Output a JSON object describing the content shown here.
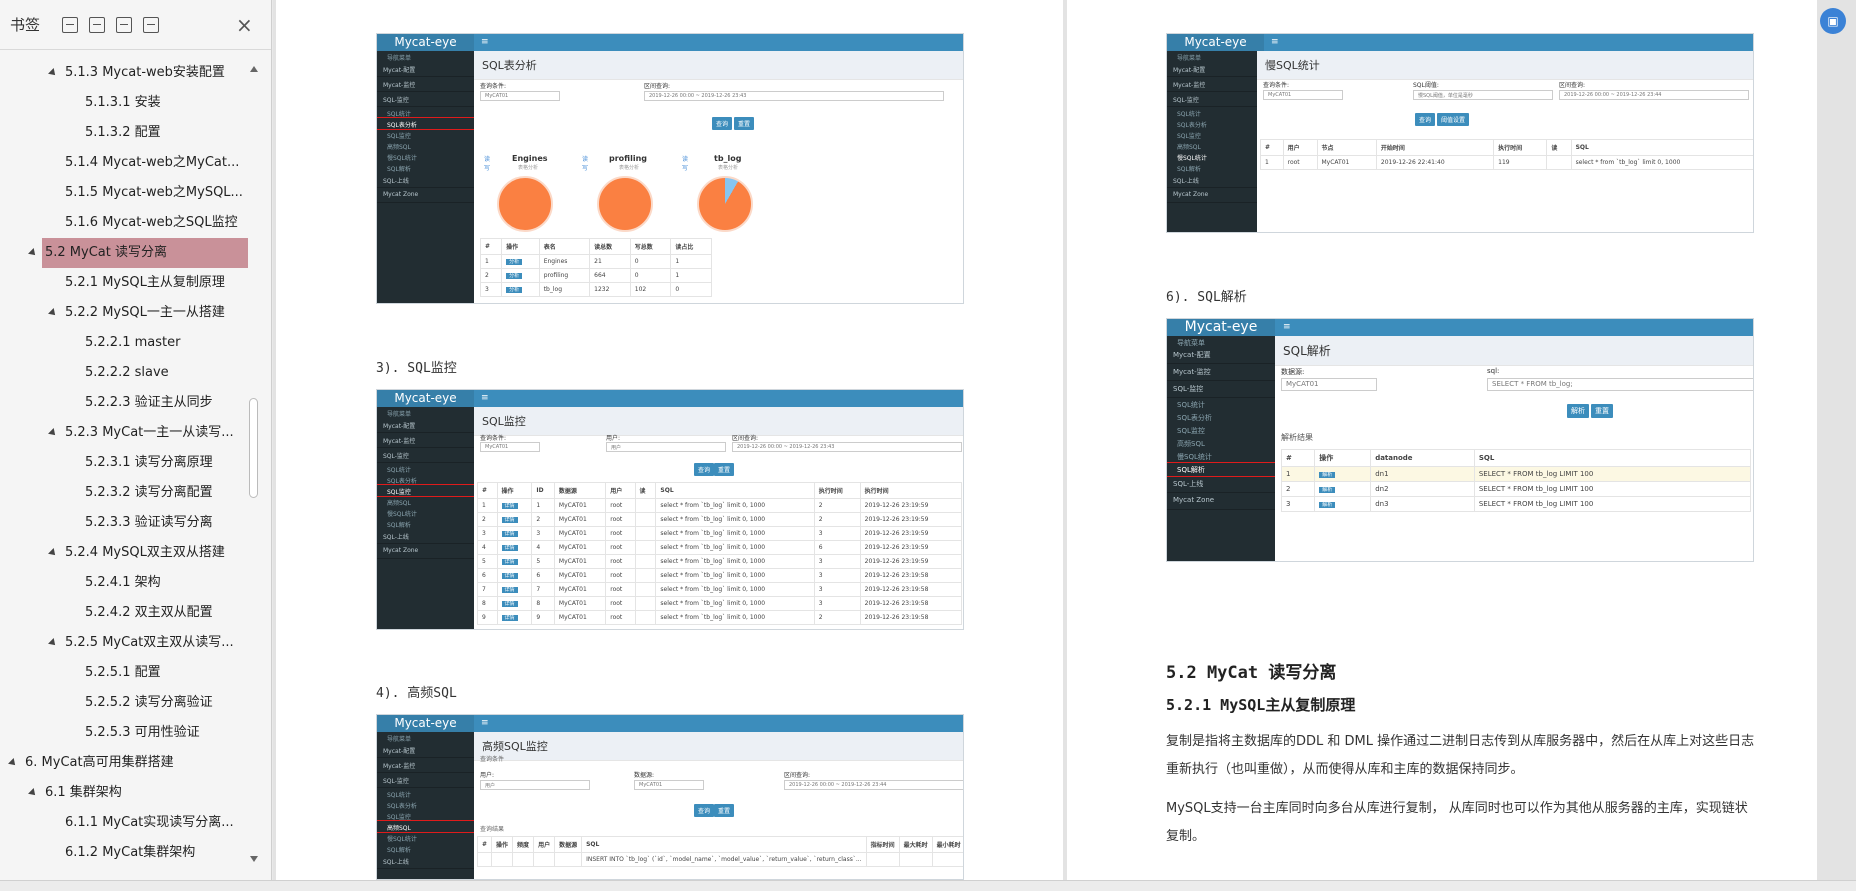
{
  "sidebar": {
    "title": "书签",
    "items": [
      {
        "label": "5.1.3 Mycat-web安装配置",
        "level": 3,
        "expanded": true
      },
      {
        "label": "5.1.3.1 安装",
        "level": 4
      },
      {
        "label": "5.1.3.2 配置",
        "level": 4
      },
      {
        "label": "5.1.4 Mycat-web之MyCat...",
        "level": 3
      },
      {
        "label": "5.1.5 Mycat-web之MySQL...",
        "level": 3
      },
      {
        "label": "5.1.6 Mycat-web之SQL监控",
        "level": 3
      },
      {
        "label": "5.2 MyCat 读写分离",
        "level": 2,
        "expanded": true,
        "selected": true
      },
      {
        "label": "5.2.1 MySQL主从复制原理",
        "level": 3
      },
      {
        "label": "5.2.2 MySQL一主一从搭建",
        "level": 3,
        "expanded": true
      },
      {
        "label": "5.2.2.1 master",
        "level": 4
      },
      {
        "label": "5.2.2.2 slave",
        "level": 4
      },
      {
        "label": "5.2.2.3 验证主从同步",
        "level": 4
      },
      {
        "label": "5.2.3 MyCat一主一从读写...",
        "level": 3,
        "expanded": true
      },
      {
        "label": "5.2.3.1 读写分离原理",
        "level": 4
      },
      {
        "label": "5.2.3.2 读写分离配置",
        "level": 4
      },
      {
        "label": "5.2.3.3 验证读写分离",
        "level": 4
      },
      {
        "label": "5.2.4 MySQL双主双从搭建",
        "level": 3,
        "expanded": true
      },
      {
        "label": "5.2.4.1 架构",
        "level": 4
      },
      {
        "label": "5.2.4.2 双主双从配置",
        "level": 4
      },
      {
        "label": "5.2.5 MyCat双主双从读写...",
        "level": 3,
        "expanded": true
      },
      {
        "label": "5.2.5.1 配置",
        "level": 4
      },
      {
        "label": "5.2.5.2 读写分离验证",
        "level": 4
      },
      {
        "label": "5.2.5.3 可用性验证",
        "level": 4
      },
      {
        "label": "6. MyCat高可用集群搭建",
        "level": 1,
        "expanded": true
      },
      {
        "label": "6.1 集群架构",
        "level": 2,
        "expanded": true
      },
      {
        "label": "6.1.1 MyCat实现读写分离...",
        "level": 3
      },
      {
        "label": "6.1.2 MyCat集群架构",
        "level": 3
      }
    ]
  },
  "shots": {
    "logo": "Mycat-eye",
    "menu_label": "导航菜单",
    "nav": [
      "Mycat-配置",
      "Mycat-监控",
      "SQL-监控",
      "SQL-上线",
      "Mycat Zone"
    ],
    "subnav": [
      "SQL统计",
      "SQL表分析",
      "SQL监控",
      "高频SQL",
      "慢SQL统计",
      "SQL解析"
    ],
    "query_btn": "查询",
    "reset_btn": "重置",
    "table_analysis": {
      "title": "SQL表分析",
      "label_cond": "查询条件:",
      "label_range": "区间查询:",
      "db": "MyCAT01",
      "range": "2019-12-26 00:00 ~ 2019-12-26 23:43",
      "pies": [
        {
          "name": "Engines",
          "sub": "表格分析"
        },
        {
          "name": "profiling",
          "sub": "表格分析"
        },
        {
          "name": "tb_log",
          "sub": "表格分析"
        }
      ],
      "legend": [
        "读",
        "写"
      ],
      "headers": [
        "#",
        "操作",
        "表名",
        "读总数",
        "写总数",
        "读占比"
      ],
      "rows": [
        [
          "1",
          "分析",
          "Engines",
          "21",
          "0",
          "1"
        ],
        [
          "2",
          "分析",
          "profiling",
          "664",
          "0",
          "1"
        ],
        [
          "3",
          "分析",
          "tb_log",
          "1232",
          "102",
          "0"
        ]
      ]
    },
    "sql_monitor": {
      "title": "SQL监控",
      "label_cond": "查询条件:",
      "label_user": "用户:",
      "label_range": "区间查询:",
      "user_ph": "用户",
      "db": "MyCAT01",
      "range": "2019-12-26 00:00 ~ 2019-12-26 23:43",
      "headers": [
        "#",
        "操作",
        "ID",
        "数据源",
        "用户",
        "读",
        "SQL",
        "执行时间",
        "执行时间"
      ],
      "rows": [
        [
          "1",
          "详情",
          "1",
          "MyCAT01",
          "root",
          "",
          "select * from `tb_log` limit 0, 1000",
          "2",
          "2019-12-26 23:19:59"
        ],
        [
          "2",
          "详情",
          "2",
          "MyCAT01",
          "root",
          "",
          "select * from `tb_log` limit 0, 1000",
          "2",
          "2019-12-26 23:19:59"
        ],
        [
          "3",
          "详情",
          "3",
          "MyCAT01",
          "root",
          "",
          "select * from `tb_log` limit 0, 1000",
          "3",
          "2019-12-26 23:19:59"
        ],
        [
          "4",
          "详情",
          "4",
          "MyCAT01",
          "root",
          "",
          "select * from `tb_log` limit 0, 1000",
          "6",
          "2019-12-26 23:19:59"
        ],
        [
          "5",
          "详情",
          "5",
          "MyCAT01",
          "root",
          "",
          "select * from `tb_log` limit 0, 1000",
          "3",
          "2019-12-26 23:19:59"
        ],
        [
          "6",
          "详情",
          "6",
          "MyCAT01",
          "root",
          "",
          "select * from `tb_log` limit 0, 1000",
          "3",
          "2019-12-26 23:19:58"
        ],
        [
          "7",
          "详情",
          "7",
          "MyCAT01",
          "root",
          "",
          "select * from `tb_log` limit 0, 1000",
          "3",
          "2019-12-26 23:19:58"
        ],
        [
          "8",
          "详情",
          "8",
          "MyCAT01",
          "root",
          "",
          "select * from `tb_log` limit 0, 1000",
          "3",
          "2019-12-26 23:19:58"
        ],
        [
          "9",
          "详情",
          "9",
          "MyCAT01",
          "root",
          "",
          "select * from `tb_log` limit 0, 1000",
          "2",
          "2019-12-26 23:19:58"
        ]
      ]
    },
    "freq_sql": {
      "title": "高频SQL监控",
      "cond_section": "查询条件",
      "label_user": "用户:",
      "label_db": "数据源:",
      "label_range": "区间查询:",
      "user_ph": "用户",
      "db": "MyCAT01",
      "range": "2019-12-26 00:00 ~ 2019-12-26 23:44",
      "result_section": "查询结果",
      "headers": [
        "#",
        "操作",
        "频度",
        "用户",
        "数据源",
        "SQL",
        "指标时间",
        "最大耗时",
        "最小耗时"
      ],
      "rows": [
        [
          "",
          "",
          "",
          "",
          "",
          "INSERT INTO `tb_log` (`id`, `model_name`, `model_value`, `return_value`, `return_class`...",
          "",
          "",
          ""
        ]
      ]
    },
    "slow_sql": {
      "title": "慢SQL统计",
      "label_cond": "查询条件:",
      "label_sql": "SQL阈值:",
      "label_range": "区间查询:",
      "db": "MyCAT01",
      "sql_ph": "慢SQL阈值，单位是毫秒",
      "range": "2019-12-26 00:00 ~ 2019-12-26 23:44",
      "btn_threshold": "阈值设置",
      "headers": [
        "#",
        "用户",
        "节点",
        "开始时间",
        "执行时间",
        "读",
        "SQL"
      ],
      "rows": [
        [
          "1",
          "root",
          "MyCAT01",
          "2019-12-26 22:41:40",
          "119",
          "",
          "select * from `tb_log` limit 0, 1000"
        ]
      ]
    },
    "sql_parse": {
      "title": "SQL解析",
      "label_db": "数据源:",
      "label_sql": "sql:",
      "db": "MyCAT01",
      "sql_value": "SELECT * FROM tb_log;",
      "btn_parse": "解析",
      "result_section": "解析结果",
      "headers": [
        "#",
        "操作",
        "datanode",
        "SQL"
      ],
      "rows": [
        [
          "1",
          "解析",
          "dn1",
          "SELECT * FROM tb_log LIMIT 100"
        ],
        [
          "2",
          "解析",
          "dn2",
          "SELECT * FROM tb_log LIMIT 100"
        ],
        [
          "3",
          "解析",
          "dn3",
          "SELECT * FROM tb_log LIMIT 100"
        ]
      ]
    }
  },
  "captions": {
    "c3": "3). SQL监控",
    "c4": "4). 高频SQL",
    "c6": "6). SQL解析"
  },
  "doc": {
    "h2": "5.2 MyCat 读写分离",
    "h3": "5.2.1 MySQL主从复制原理",
    "p1": "复制是指将主数据库的DDL 和 DML 操作通过二进制日志传到从库服务器中，然后在从库上对这些日志重新执行（也叫重做），从而使得从库和主库的数据保持同步。",
    "p2": "MySQL支持一台主库同时向多台从库进行复制， 从库同时也可以作为其他从服务器的主库，实现链状复制。"
  }
}
